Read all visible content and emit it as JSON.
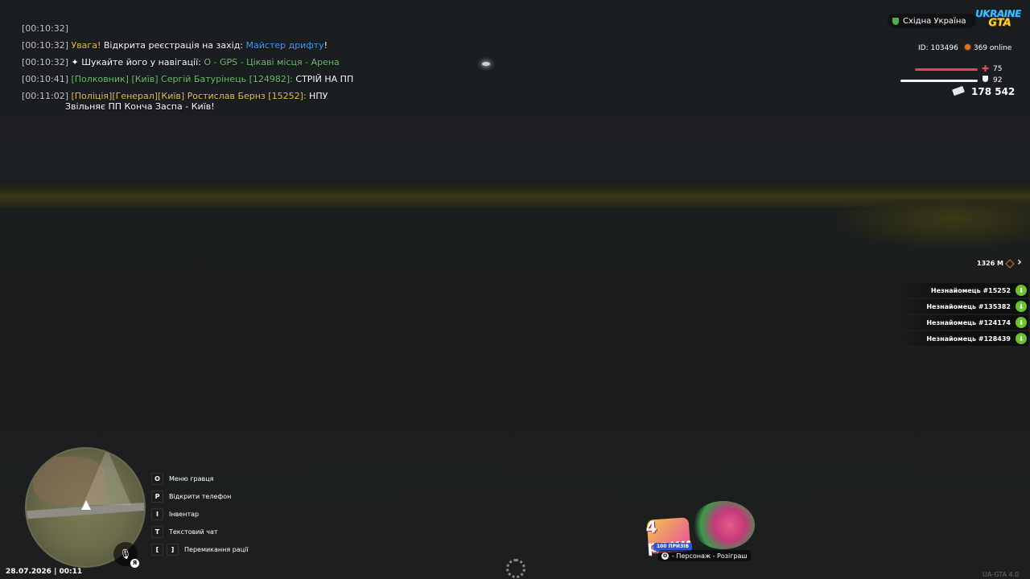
{
  "chat": {
    "lines": [
      {
        "ts": "[00:10:32]",
        "parts": []
      },
      {
        "ts": "[00:10:32]",
        "p1": "Увага!",
        "p2": " Відкрита реєстрація на захід: ",
        "p3": "Майстер дрифту",
        "p4": "!"
      },
      {
        "ts": "[00:10:32]",
        "p1": " ✦ Шукайте його у навігації: ",
        "p2": "O - GPS - Цікаві місця - Арена"
      },
      {
        "ts": "[00:10:41]",
        "p1": " [Полковник] [Київ] Сергій Батурінець [124982]:",
        "p2": " СТРІЙ НА ПП"
      },
      {
        "ts": "[00:11:02]",
        "p1": " [Поліція][Генерал][Київ] Ростислав Бернз [15252]:",
        "p2": " НПУ",
        "p3": "Звільняє ПП Конча Заспа - Київ!"
      }
    ]
  },
  "hud": {
    "region": "Східна Україна",
    "logo_top": "UKRAINE",
    "logo_bottom": "GTA",
    "id_label": "ID: 103496",
    "online": "369 online",
    "health": "75",
    "armor": "92",
    "health_level": 0.75,
    "armor_level": 0.92,
    "money": "178 542",
    "distance": "1326 М"
  },
  "players": [
    {
      "name": "Незнайомець #15252"
    },
    {
      "name": "Незнайомець #135382"
    },
    {
      "name": "Незнайомець #124174"
    },
    {
      "name": "Незнайомець #128439"
    }
  ],
  "hotkeys": [
    {
      "key": "O",
      "label": "Меню гравця"
    },
    {
      "key": "P",
      "label": "Відкрити телефон"
    },
    {
      "key": "I",
      "label": "Інвентар"
    },
    {
      "key": "T",
      "label": "Текстовий чат"
    },
    {
      "key": "[",
      "key2": "]",
      "label": "Перемикання рації"
    }
  ],
  "mic_badge": "Я",
  "datetime": "28.07.2026 | 00:11",
  "promo": {
    "badge": "4 роки",
    "prizes": "100 ПРИЗІВ",
    "key": "O",
    "caption": " - Персонаж - Розіграш"
  },
  "version": "UA-GTA 4.0",
  "colors": {
    "health": "#e8455c",
    "armor": "#f2f2f2",
    "chat_yellow": "#e9c34a",
    "chat_blue": "#3ba3ff",
    "chat_green": "#6cc36a",
    "mic_green": "#6cc32e"
  }
}
